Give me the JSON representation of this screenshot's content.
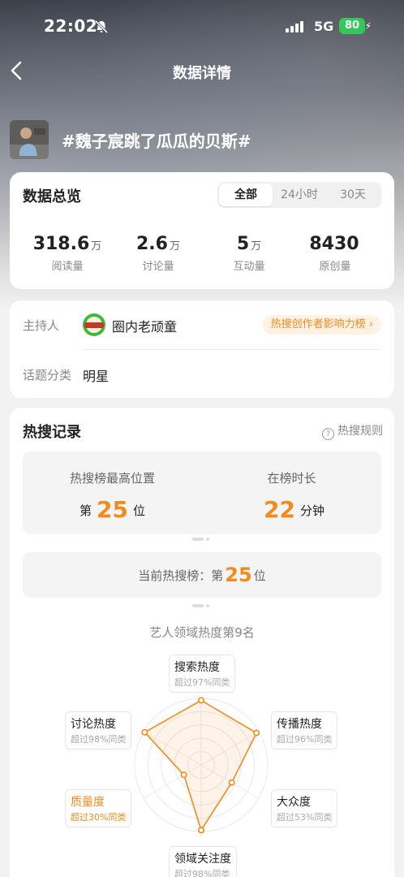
{
  "status_bar": {
    "time": "22:02",
    "network": "5G",
    "battery": "80"
  },
  "nav": {
    "title": "数据详情"
  },
  "topic": {
    "title": "#魏子宸跳了瓜瓜的贝斯#"
  },
  "overview": {
    "title": "数据总览",
    "tabs": [
      {
        "label": "全部",
        "active": true
      },
      {
        "label": "24小时",
        "active": false
      },
      {
        "label": "30天",
        "active": false
      }
    ],
    "stats": [
      {
        "value": "318.6",
        "unit": "万",
        "label": "阅读量"
      },
      {
        "value": "2.6",
        "unit": "万",
        "label": "讨论量"
      },
      {
        "value": "5",
        "unit": "万",
        "label": "互动量"
      },
      {
        "value": "8430",
        "unit": "",
        "label": "原创量"
      }
    ]
  },
  "host": {
    "label": "主持人",
    "name": "圈内老顽童",
    "badge": "热搜创作者影响力榜 ›",
    "category_label": "话题分类",
    "category_value": "明星"
  },
  "hot_search": {
    "title": "热搜记录",
    "rules_link": "热搜规则",
    "peak_label": "热搜榜最高位置",
    "peak_prefix": "第",
    "peak_value": "25",
    "peak_suffix": "位",
    "duration_label": "在榜时长",
    "duration_value": "22",
    "duration_unit": "分钟",
    "current_label": "当前热搜榜：第",
    "current_value": "25",
    "current_suffix": "位",
    "rank_title": "艺人领域热度第9名"
  },
  "radar": {
    "dimensions": [
      {
        "name": "搜索热度",
        "sub": "超过97%同类",
        "percentile": 97,
        "weak": false
      },
      {
        "name": "传播热度",
        "sub": "超过96%同类",
        "percentile": 96,
        "weak": false
      },
      {
        "name": "大众度",
        "sub": "超过53%同类",
        "percentile": 53,
        "weak": false
      },
      {
        "name": "领域关注度",
        "sub": "超过98%同类",
        "percentile": 98,
        "weak": false
      },
      {
        "name": "质量度",
        "sub": "超过30%同类",
        "percentile": 30,
        "weak": true
      },
      {
        "name": "讨论热度",
        "sub": "超过98%同类",
        "percentile": 98,
        "weak": false
      }
    ],
    "accent_color": "#f28a1e"
  }
}
